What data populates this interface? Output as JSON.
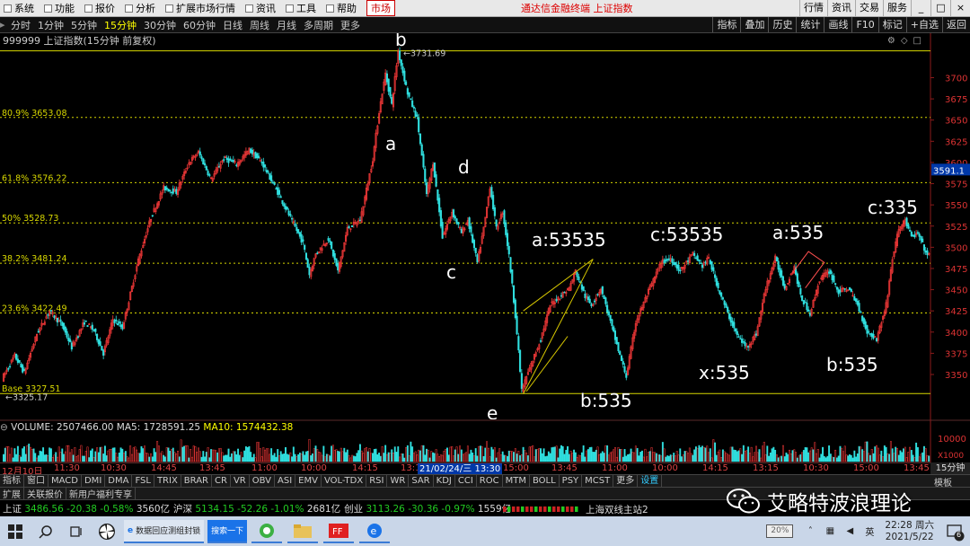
{
  "menu": {
    "items": [
      "系统",
      "功能",
      "报价",
      "分析",
      "扩展市场行情",
      "资讯",
      "工具",
      "帮助"
    ],
    "active": "市场",
    "title": "通达信金融终端  上证指数",
    "right_buttons": [
      "行情",
      "资讯",
      "交易",
      "服务"
    ],
    "window_controls": [
      "_",
      "□",
      "×"
    ]
  },
  "periods": {
    "items": [
      "分时",
      "1分钟",
      "5分钟",
      "15分钟",
      "30分钟",
      "60分钟",
      "日线",
      "周线",
      "月线",
      "多周期",
      "更多"
    ],
    "active_index": 3,
    "tools": [
      "指标",
      "叠加",
      "历史",
      "统计",
      "画线",
      "F10",
      "标记",
      "+自选",
      "返回"
    ]
  },
  "chart": {
    "header": "999999 上证指数(15分钟 前复权)",
    "current_price": "3591.1",
    "price_ticks": [
      "3700",
      "3675",
      "3650",
      "3625",
      "3600",
      "3575",
      "3550",
      "3525",
      "3500",
      "3475",
      "3450",
      "3425",
      "3400",
      "3375",
      "3350"
    ],
    "fib_levels": [
      {
        "label": "80.9% 3653.08",
        "value": 3653.08
      },
      {
        "label": "61.8% 3576.22",
        "value": 3576.22
      },
      {
        "label": "50% 3528.73",
        "value": 3528.73
      },
      {
        "label": "38.2% 3481.24",
        "value": 3481.24
      },
      {
        "label": "23.6% 3422.49",
        "value": 3422.49
      },
      {
        "label": "Base 3327.51",
        "value": 3327.51
      }
    ],
    "top_line_value": 3731.69,
    "high_label": "3731.69",
    "low_label": "3325.17",
    "wave_labels": [
      "b",
      "a",
      "d",
      "c",
      "e",
      "a:53535",
      "b:535",
      "c:53535",
      "x:535",
      "a:535",
      "b:535",
      "c:335"
    ],
    "colors": {
      "up": "#ff3b3b",
      "down": "#30e0e0",
      "fib": "#d8d800",
      "channel": "#d8c800",
      "axis": "#8b1a1a"
    }
  },
  "volume": {
    "label": "VOLUME: 2507466.00",
    "ma5": "MA5: 1728591.25",
    "ma10": "MA10: 1574432.38",
    "tick": "10000",
    "unit": "X1000"
  },
  "time_axis": {
    "labels": [
      "12月10日",
      "11:30",
      "10:30",
      "14:45",
      "13:45",
      "11:00",
      "10:00",
      "14:15",
      "13:15",
      "15:00",
      "13:45",
      "11:00",
      "10:00",
      "14:15",
      "13:15",
      "10:30",
      "15:00",
      "13:45"
    ],
    "cursor": "21/02/24/三 13:30",
    "period": "15分钟"
  },
  "indicators": {
    "items": [
      "指标",
      "窗口",
      "MACD",
      "DMI",
      "DMA",
      "FSL",
      "TRIX",
      "BRAR",
      "CR",
      "VR",
      "OBV",
      "ASI",
      "EMV",
      "VOL-TDX",
      "RSI",
      "WR",
      "SAR",
      "KDJ",
      "CCI",
      "ROC",
      "MTM",
      "BOLL",
      "PSY",
      "MCST",
      "更多",
      "设置"
    ],
    "template": "模板"
  },
  "info_tabs": [
    "扩展",
    "关联报价",
    "新用户福利专享"
  ],
  "ticker": {
    "items": [
      {
        "name": "上证",
        "price": "3486.56",
        "change": "-20.38",
        "pct": "-0.58%",
        "amount": "3560亿"
      },
      {
        "name": "沪深",
        "price": "5134.15",
        "change": "-52.26",
        "pct": "-1.01%",
        "amount": "2681亿"
      },
      {
        "name": "创业",
        "price": "3113.26",
        "change": "-30.36",
        "pct": "-0.97%",
        "amount": "1559亿"
      }
    ],
    "station": "上海双线主站2"
  },
  "watermark": "艾略特波浪理论",
  "taskbar": {
    "apps": [
      {
        "label": "数据回应测组封锁"
      },
      {
        "label": "搜索一下"
      }
    ],
    "battery": "20%",
    "ime": "英",
    "time": "22:28 周六",
    "date": "2021/5/22",
    "badge": "6"
  }
}
